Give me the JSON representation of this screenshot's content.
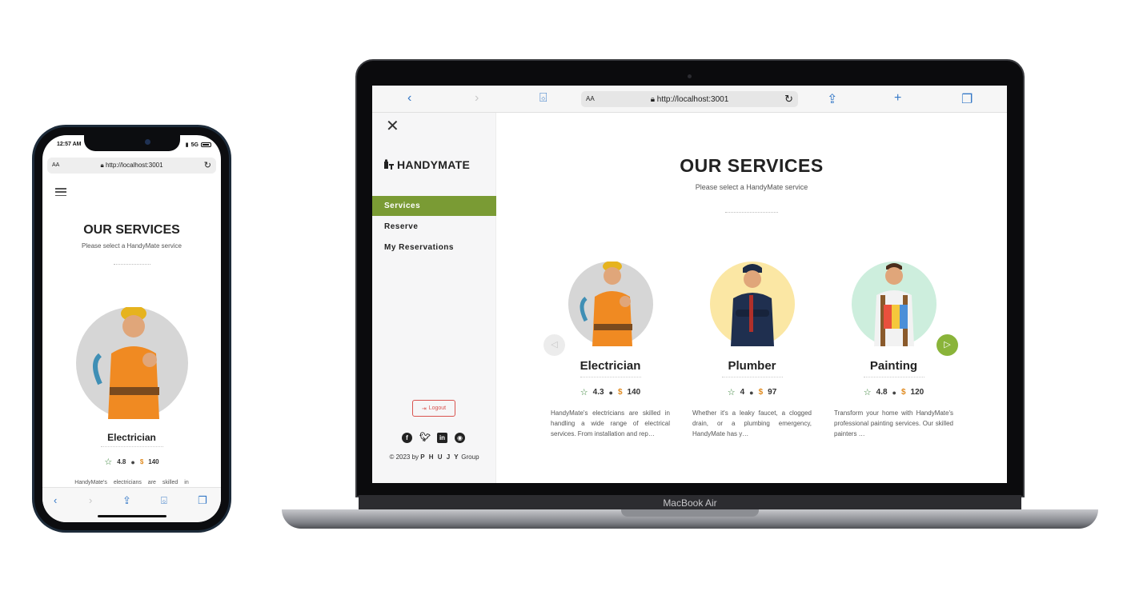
{
  "phone": {
    "time": "12:57 AM",
    "signal": "5G",
    "url_aa": "AA",
    "url": "http://localhost:3001",
    "title": "OUR SERVICES",
    "subtitle": "Please select a HandyMate service",
    "card": {
      "name": "Electrician",
      "rating": "4.8",
      "price": "140",
      "description": "HandyMate's electricians are skilled in"
    }
  },
  "laptop": {
    "url_aa": "AA",
    "url": "http://localhost:3001",
    "model_label": "MacBook Air",
    "brand": "HANDYMATE",
    "nav": [
      {
        "label": "Services",
        "active": true
      },
      {
        "label": "Reserve",
        "active": false
      },
      {
        "label": "My Reservations",
        "active": false
      }
    ],
    "logout_label": "Logout",
    "copyright_prefix": "© 2023 by",
    "copyright_name": "P H U J Y",
    "copyright_suffix": "Group",
    "title": "OUR SERVICES",
    "subtitle": "Please select a HandyMate service",
    "services": [
      {
        "name": "Electrician",
        "rating": "4.3",
        "price": "140",
        "avatar_color": "#d6d6d6",
        "description": "HandyMate's electricians are skilled in handling a wide range of electrical services. From installation and rep…"
      },
      {
        "name": "Plumber",
        "rating": "4",
        "price": "97",
        "avatar_color": "#fbe7a4",
        "description": "Whether it's a leaky faucet, a clogged drain, or a plumbing emergency, HandyMate has y…"
      },
      {
        "name": "Painting",
        "rating": "4.8",
        "price": "120",
        "avatar_color": "#cdeedd",
        "description": "Transform your home with HandyMate's professional painting services. Our skilled painters …"
      }
    ]
  },
  "currency_symbol": "$",
  "colors": {
    "accent": "#7a9b34",
    "next_button": "#8ab43a",
    "logout": "#d9534f",
    "star": "#2f7d2f",
    "price": "#e08a1e"
  },
  "icons": [
    "close-icon",
    "star-icon",
    "dollar-icon",
    "logout-icon",
    "facebook-icon",
    "twitter-icon",
    "linkedin-icon",
    "github-icon",
    "chevron-left-icon",
    "chevron-right-icon",
    "share-icon",
    "bookmarks-icon",
    "tabs-icon",
    "plus-icon",
    "reload-icon",
    "lock-icon",
    "hamburger-icon"
  ]
}
